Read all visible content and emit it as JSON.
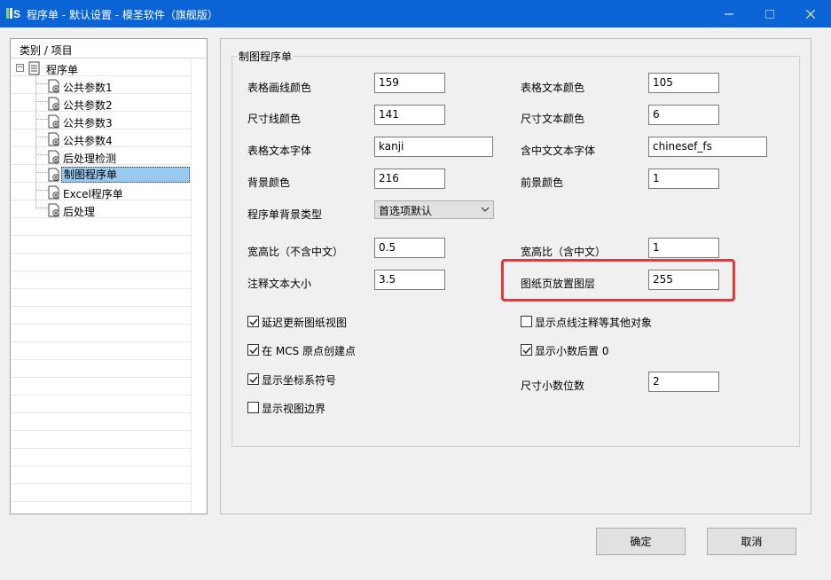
{
  "window": {
    "title": "程序单 - 默认设置 - 模圣软件（旗舰版）",
    "minimize_glyph": "—",
    "maximize_glyph": "☐",
    "close_glyph": "✕"
  },
  "tree": {
    "header": "类别 / 项目",
    "root": {
      "label": "程序单",
      "icon": "document-icon",
      "expander": "−"
    },
    "items": [
      {
        "label": "公共参数1",
        "icon": "page-gear-icon"
      },
      {
        "label": "公共参数2",
        "icon": "page-gear-icon"
      },
      {
        "label": "公共参数3",
        "icon": "page-gear-icon"
      },
      {
        "label": "公共参数4",
        "icon": "page-gear-icon"
      },
      {
        "label": "后处理检测",
        "icon": "page-gear-icon"
      },
      {
        "label": "制图程序单",
        "icon": "page-gear-icon",
        "selected": true
      },
      {
        "label": "Excel程序单",
        "icon": "page-gear-icon"
      },
      {
        "label": "后处理",
        "icon": "page-gear-icon"
      }
    ]
  },
  "group": {
    "title": "制图程序单",
    "fields": {
      "table_line_color": {
        "label": "表格画线颜色",
        "value": "159"
      },
      "table_text_color": {
        "label": "表格文本颜色",
        "value": "105"
      },
      "dim_line_color": {
        "label": "尺寸线颜色",
        "value": "141"
      },
      "dim_text_color": {
        "label": "尺寸文本颜色",
        "value": "6"
      },
      "table_text_font": {
        "label": "表格文本字体",
        "value": "kanji"
      },
      "chinese_text_font": {
        "label": "含中文文本字体",
        "value": "chinesef_fs"
      },
      "bg_color": {
        "label": "背景颜色",
        "value": "216"
      },
      "fg_color": {
        "label": "前景颜色",
        "value": "1"
      },
      "bg_type": {
        "label": "程序单背景类型",
        "value": "首选项默认"
      },
      "aspect_no_cn": {
        "label": "宽高比（不含中文）",
        "value": "0.5"
      },
      "aspect_cn": {
        "label": "宽高比（含中文）",
        "value": "1"
      },
      "note_text_size": {
        "label": "注释文本大小",
        "value": "3.5"
      },
      "sheet_layer": {
        "label": "图纸页放置图层",
        "value": "255"
      },
      "dim_decimals": {
        "label": "尺寸小数位数",
        "value": "2"
      }
    },
    "checkboxes": {
      "delay_update": {
        "label": "延迟更新图纸视图",
        "checked": true
      },
      "create_at_mcs": {
        "label": "在 MCS 原点创建点",
        "checked": true
      },
      "show_csys": {
        "label": "显示坐标系符号",
        "checked": true
      },
      "show_view_border": {
        "label": "显示视图边界",
        "checked": false
      },
      "show_point_notes": {
        "label": "显示点线注释等其他对象",
        "checked": false
      },
      "show_trailing_zero": {
        "label": "显示小数后置 0",
        "checked": true
      }
    }
  },
  "buttons": {
    "ok": "确定",
    "cancel": "取消"
  },
  "colors": {
    "titlebar": "#0a64d6",
    "highlight": "#e0393e",
    "selection": "#99c9ef"
  }
}
